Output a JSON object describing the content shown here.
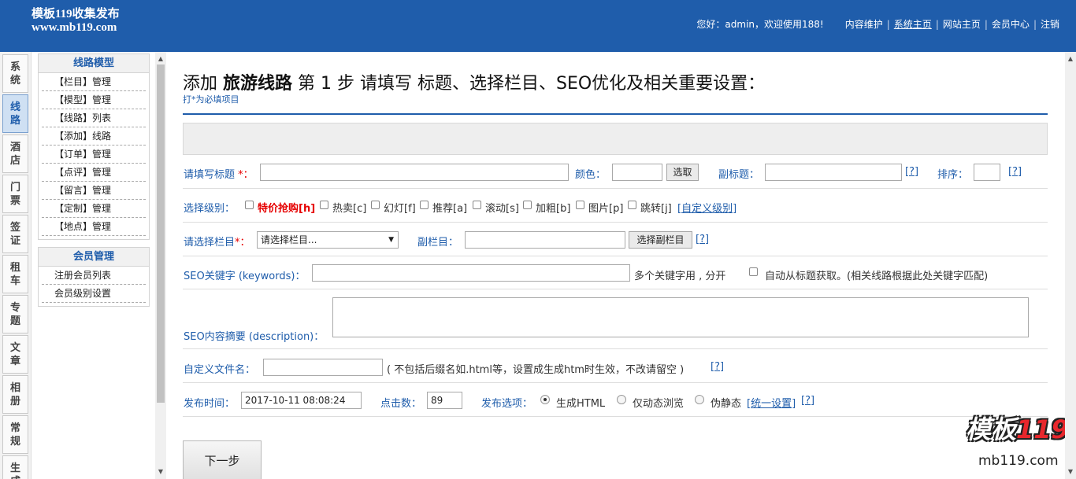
{
  "header": {
    "logo_line1": "模板119收集发布",
    "logo_line2": "www.mb119.com",
    "greeting": "您好：admin，欢迎使用188!",
    "links": [
      "内容维护",
      "系统主页",
      "网站主页",
      "会员中心",
      "注销"
    ]
  },
  "left_tabs": [
    {
      "l1": "系",
      "l2": "统"
    },
    {
      "l1": "线",
      "l2": "路"
    },
    {
      "l1": "酒",
      "l2": "店"
    },
    {
      "l1": "门",
      "l2": "票"
    },
    {
      "l1": "签",
      "l2": "证"
    },
    {
      "l1": "租",
      "l2": "车"
    },
    {
      "l1": "专",
      "l2": "题"
    },
    {
      "l1": "文",
      "l2": "章"
    },
    {
      "l1": "相",
      "l2": "册"
    },
    {
      "l1": "常",
      "l2": "规"
    },
    {
      "l1": "生",
      "l2": "成"
    }
  ],
  "left_nav": {
    "section1": {
      "title": "线路模型",
      "items": [
        "【栏目】管理",
        "【模型】管理",
        "【线路】列表",
        "【添加】线路",
        "【订单】管理",
        "【点评】管理",
        "【留言】管理",
        "【定制】管理",
        "【地点】管理"
      ]
    },
    "section2": {
      "title": "会员管理",
      "items": [
        "注册会员列表",
        "会员级别设置"
      ]
    }
  },
  "page": {
    "title_prefix": "添加",
    "title_bold": "旅游线路",
    "title_suffix": "第 1 步 请填写 标题、选择栏目、SEO优化及相关重要设置：",
    "required_note": "打*为必填项目"
  },
  "form": {
    "title_label": "请填写标题",
    "required_mark": "*：",
    "color_label": "颜色：",
    "pick_button": "选取",
    "subtitle_label": "副标题：",
    "help": "[?]",
    "sort_label": "排序：",
    "level_label": "选择级别：",
    "levels": [
      "特价抢购[h]",
      "热卖[c]",
      "幻灯[f]",
      "推荐[a]",
      "滚动[s]",
      "加粗[b]",
      "图片[p]",
      "跳转[j]"
    ],
    "custom_level": "[自定义级别]",
    "column_label": "请选择栏目",
    "column_required": "*：",
    "column_select": "请选择栏目...",
    "subcolumn_label": "副栏目：",
    "subcolumn_button": "选择副栏目",
    "keywords_label": "SEO关键字 (keywords)：",
    "keywords_hint": "多个关键字用 , 分开",
    "auto_fetch": "自动从标题获取。(相关线路根据此处关键字匹配)",
    "description_label": "SEO内容摘要 (description)：",
    "filename_label": "自定义文件名：",
    "filename_hint": "( 不包括后缀名如.html等，设置成生成htm时生效，不改请留空 )",
    "publish_time_label": "发布时间：",
    "publish_time_value": "2017-10-11 08:08:24",
    "clicks_label": "点击数：",
    "clicks_value": "89",
    "publish_option_label": "发布选项：",
    "publish_options": [
      "生成HTML",
      "仅动态浏览",
      "伪静态"
    ],
    "publish_selected": "生成HTML",
    "unified_settings": "[统一设置]",
    "next_button": "下一步"
  },
  "watermark": {
    "text": "模板",
    "num": "119",
    "url": "mb119.com"
  },
  "colors": {
    "brand": "#1f5dab",
    "required": "#e60000"
  }
}
